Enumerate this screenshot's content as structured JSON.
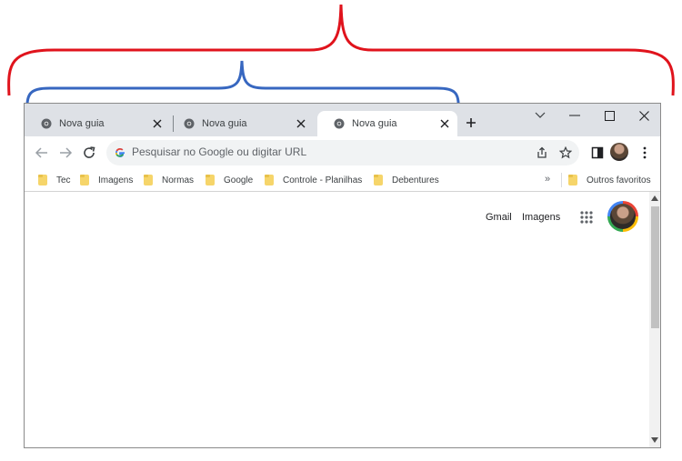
{
  "tabs": [
    {
      "title": "Nova guia",
      "active": false
    },
    {
      "title": "Nova guia",
      "active": false
    },
    {
      "title": "Nova guia",
      "active": true
    }
  ],
  "omnibox": {
    "placeholder": "Pesquisar no Google ou digitar URL"
  },
  "bookmarks": {
    "items": [
      "Tec",
      "Imagens",
      "Normas",
      "Google",
      "Controle - Planilhas",
      "Debentures"
    ],
    "overflow": "»",
    "other": "Outros favoritos"
  },
  "content": {
    "gmail": "Gmail",
    "images": "Imagens"
  },
  "colors": {
    "red_bracket": "#e0131c",
    "blue_bracket": "#3767c0",
    "tabstrip": "#dee1e6",
    "folder": "#f6d56a"
  },
  "icons": [
    "chrome-icon",
    "close-icon",
    "plus-icon",
    "chevron-down-icon",
    "minimize-icon",
    "maximize-icon",
    "back-icon",
    "forward-icon",
    "reload-icon",
    "google-g-icon",
    "share-icon",
    "star-icon",
    "side-panel-icon",
    "menu-icon",
    "folder-icon",
    "apps-grid-icon"
  ]
}
